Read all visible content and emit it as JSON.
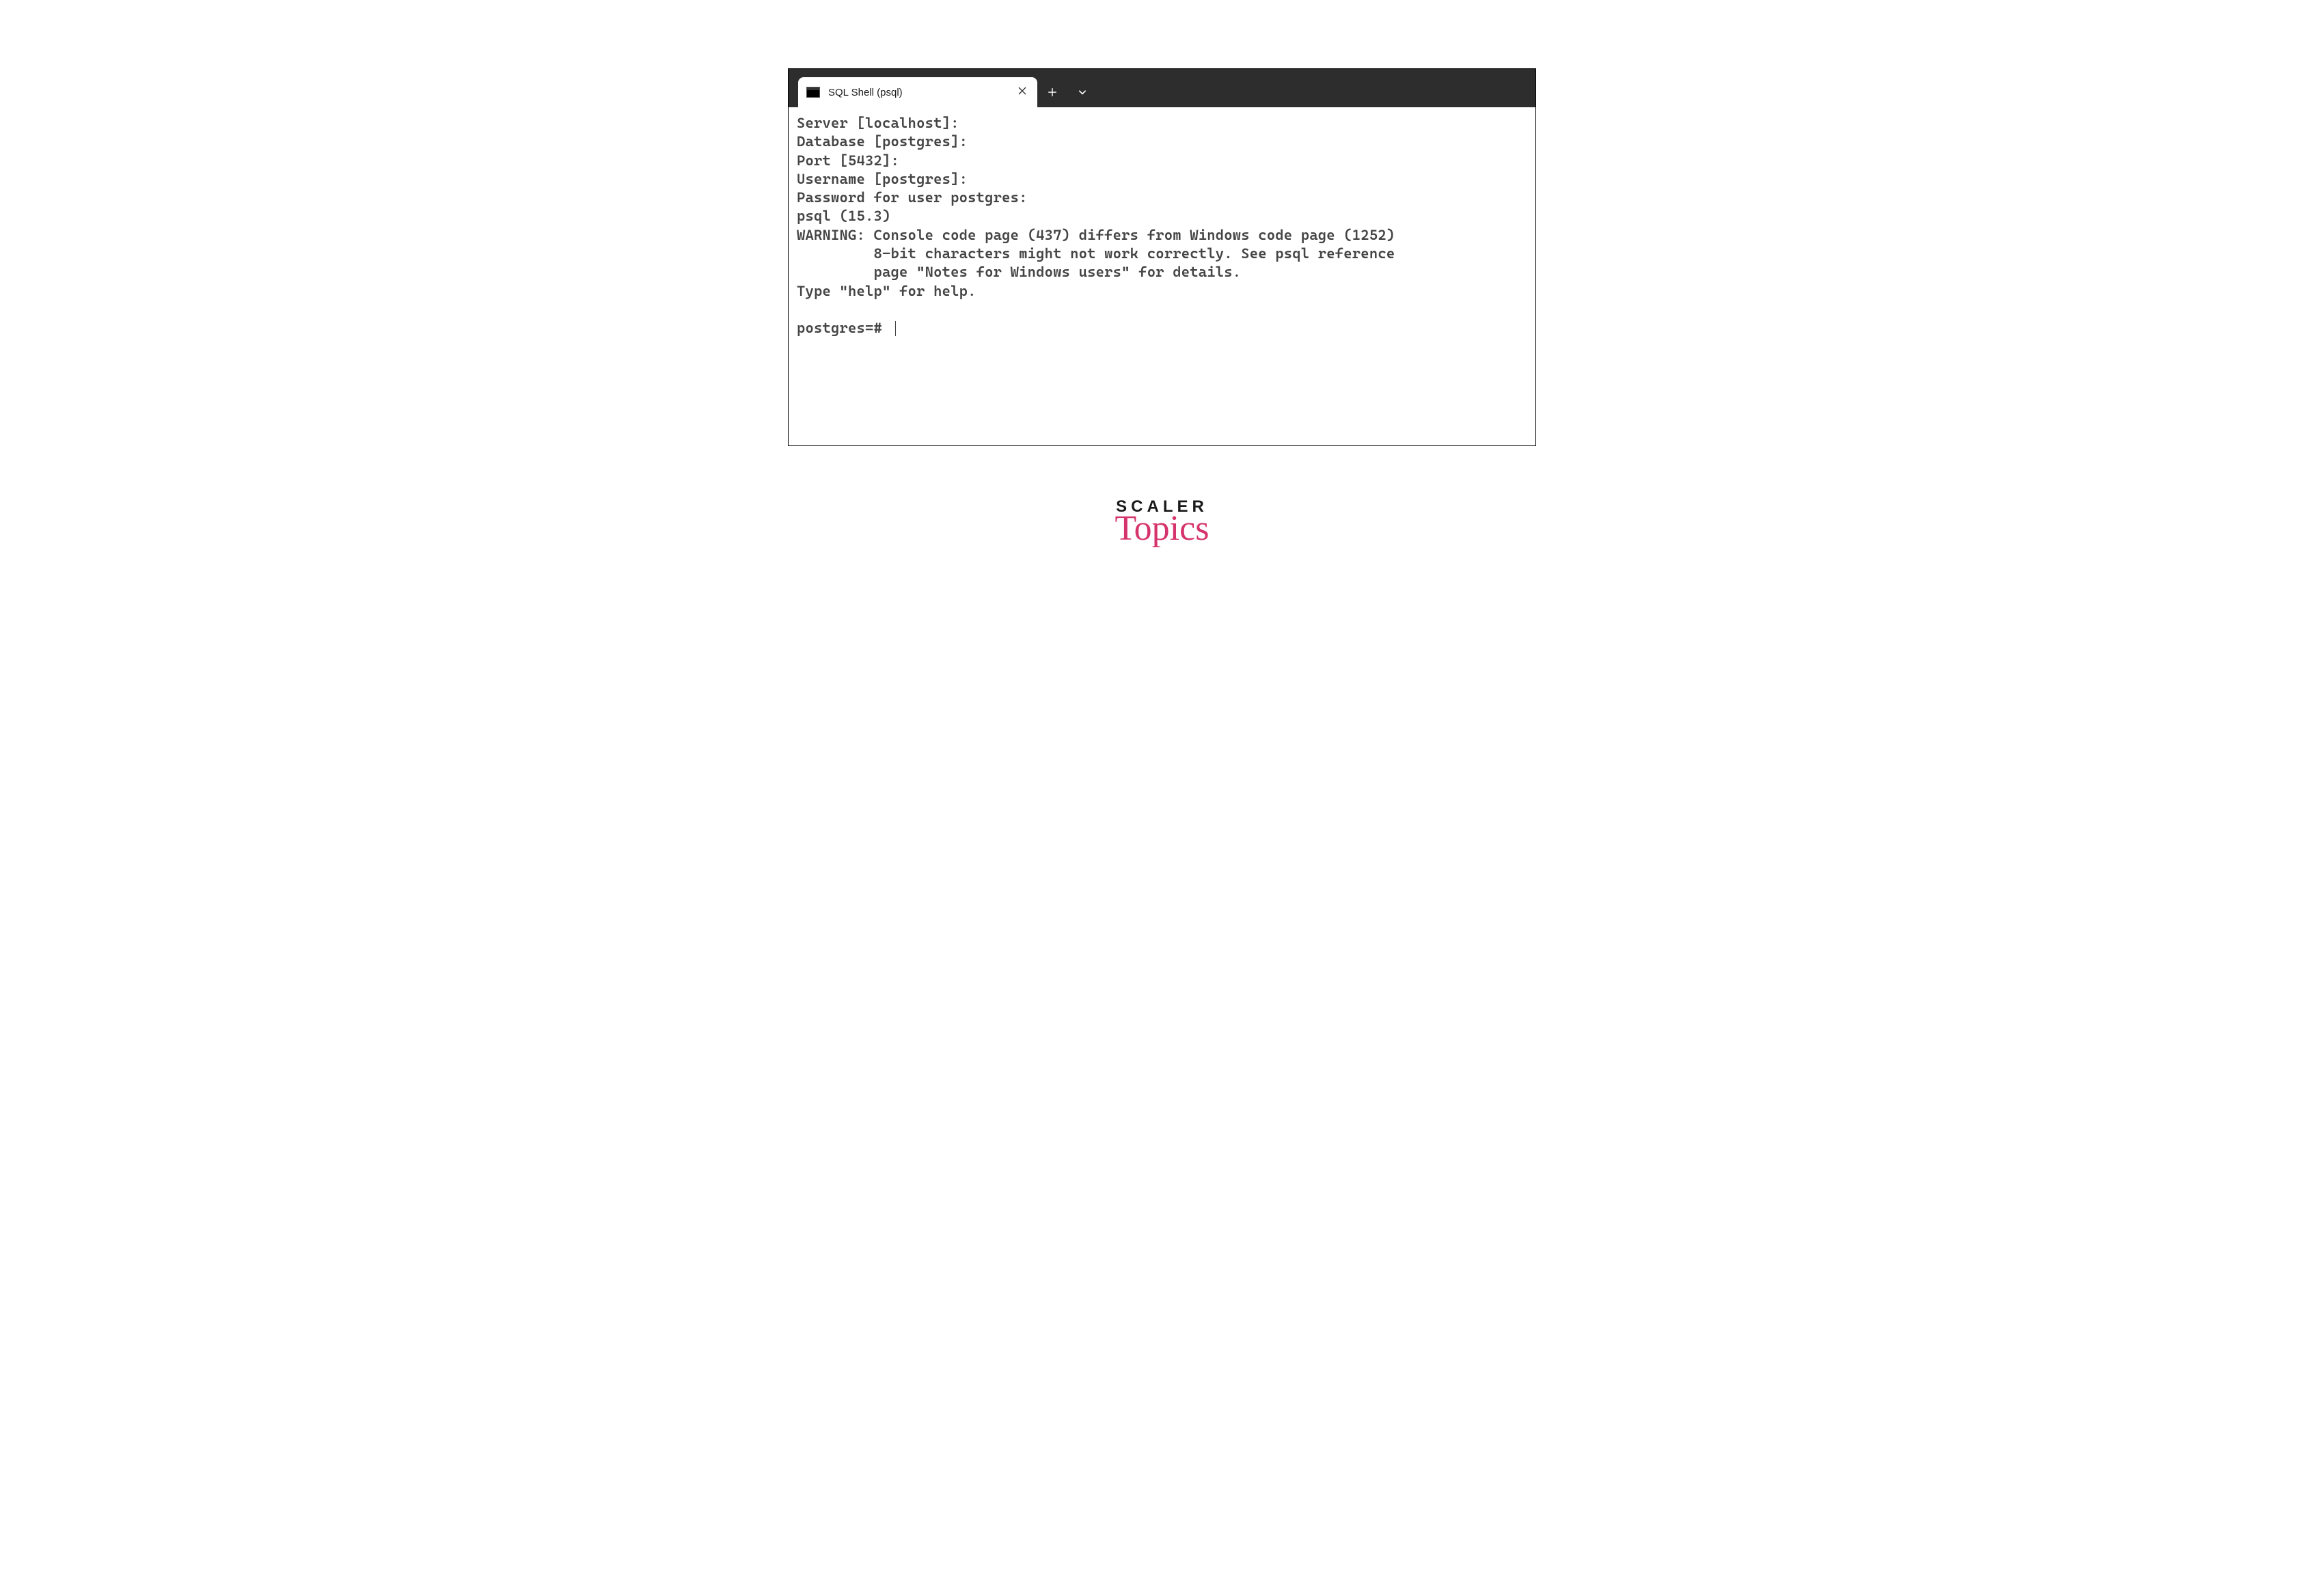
{
  "tab": {
    "title": "SQL Shell (psql)"
  },
  "terminal": {
    "lines": [
      "Server [localhost]:",
      "Database [postgres]:",
      "Port [5432]:",
      "Username [postgres]:",
      "Password for user postgres:",
      "psql (15.3)",
      "WARNING: Console code page (437) differs from Windows code page (1252)",
      "         8-bit characters might not work correctly. See psql reference",
      "         page \"Notes for Windows users\" for details.",
      "Type \"help\" for help.",
      "",
      "postgres=# "
    ]
  },
  "brand": {
    "top": "SCALER",
    "bottom": "Topics"
  }
}
